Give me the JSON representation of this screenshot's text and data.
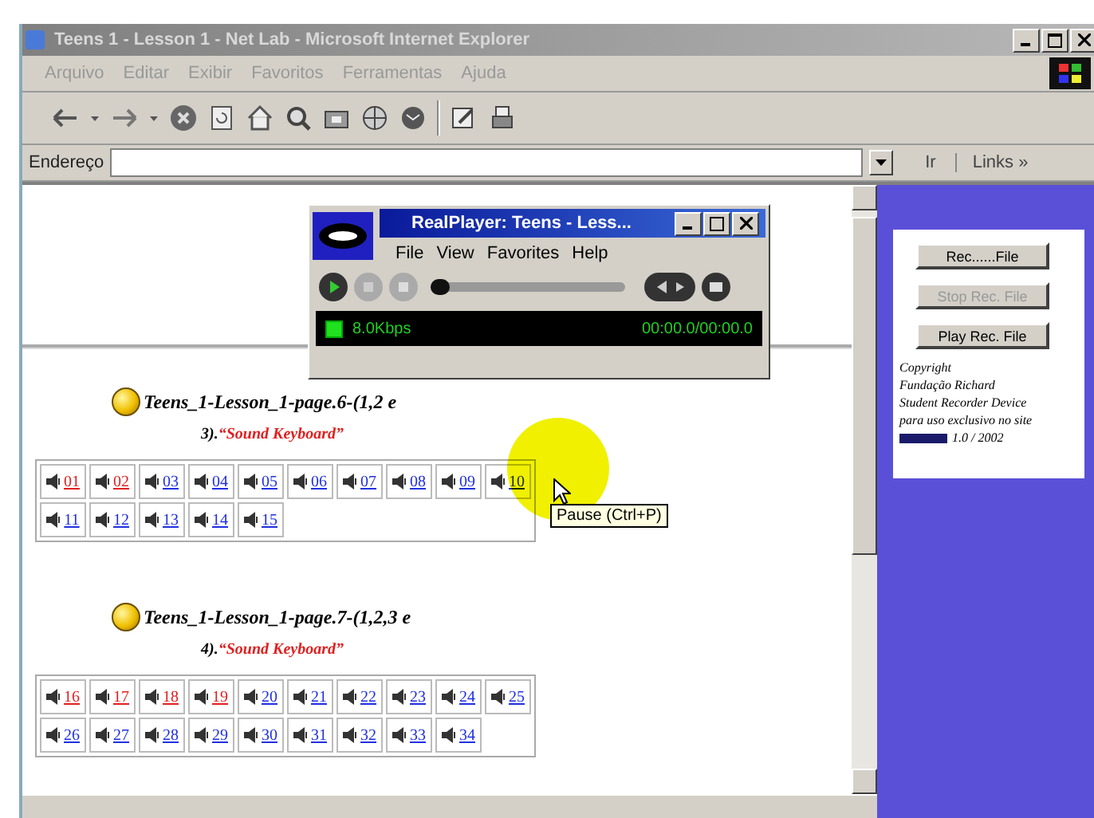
{
  "browser": {
    "title": "Teens 1 - Lesson 1 - Net Lab - Microsoft Internet Explorer",
    "menu": [
      "Arquivo",
      "Editar",
      "Exibir",
      "Favoritos",
      "Ferramentas",
      "Ajuda"
    ],
    "address_label": "Endereço",
    "go": "Ir",
    "links": "Links »"
  },
  "sections": [
    {
      "heading": "Teens_1-Lesson_1-page.6-(1,2 e",
      "number": "3).",
      "subtitle": "“Sound Keyboard”",
      "rows": [
        [
          {
            "label": "01",
            "visited": true
          },
          {
            "label": "02",
            "visited": true
          },
          {
            "label": "03",
            "visited": false
          },
          {
            "label": "04",
            "visited": false
          },
          {
            "label": "05",
            "visited": false
          },
          {
            "label": "06",
            "visited": false
          },
          {
            "label": "07",
            "visited": false
          },
          {
            "label": "08",
            "visited": false
          },
          {
            "label": "09",
            "visited": false
          },
          {
            "label": "10",
            "visited": false
          }
        ],
        [
          {
            "label": "11",
            "visited": false
          },
          {
            "label": "12",
            "visited": false
          },
          {
            "label": "13",
            "visited": false
          },
          {
            "label": "14",
            "visited": false
          },
          {
            "label": "15",
            "visited": false
          }
        ]
      ]
    },
    {
      "heading": "Teens_1-Lesson_1-page.7-(1,2,3 e",
      "number": "4).",
      "subtitle": "“Sound Keyboard”",
      "rows": [
        [
          {
            "label": "16",
            "visited": true
          },
          {
            "label": "17",
            "visited": true
          },
          {
            "label": "18",
            "visited": true
          },
          {
            "label": "19",
            "visited": true
          },
          {
            "label": "20",
            "visited": false
          },
          {
            "label": "21",
            "visited": false
          },
          {
            "label": "22",
            "visited": false
          },
          {
            "label": "23",
            "visited": false
          },
          {
            "label": "24",
            "visited": false
          },
          {
            "label": "25",
            "visited": false
          }
        ],
        [
          {
            "label": "26",
            "visited": false
          },
          {
            "label": "27",
            "visited": false
          },
          {
            "label": "28",
            "visited": false
          },
          {
            "label": "29",
            "visited": false
          },
          {
            "label": "30",
            "visited": false
          },
          {
            "label": "31",
            "visited": false
          },
          {
            "label": "32",
            "visited": false
          },
          {
            "label": "33",
            "visited": false
          },
          {
            "label": "34",
            "visited": false
          }
        ]
      ]
    }
  ],
  "recorder": {
    "buttons": [
      {
        "label": "Rec......File",
        "disabled": false
      },
      {
        "label": "Stop Rec. File",
        "disabled": true
      },
      {
        "label": "Play Rec. File",
        "disabled": false
      }
    ],
    "notes": [
      "Copyright",
      "Fundação Richard",
      "Student Recorder Device",
      "para uso exclusivo no site"
    ],
    "version": "1.0 / 2002"
  },
  "player": {
    "title": "RealPlayer: Teens - Less...",
    "menu": [
      "File",
      "View",
      "Favorites",
      "Help"
    ],
    "level": 0,
    "bitrate": "8.0Kbps",
    "time": "00:00.0/00:00.0"
  },
  "tooltip": "Pause (Ctrl+P)"
}
